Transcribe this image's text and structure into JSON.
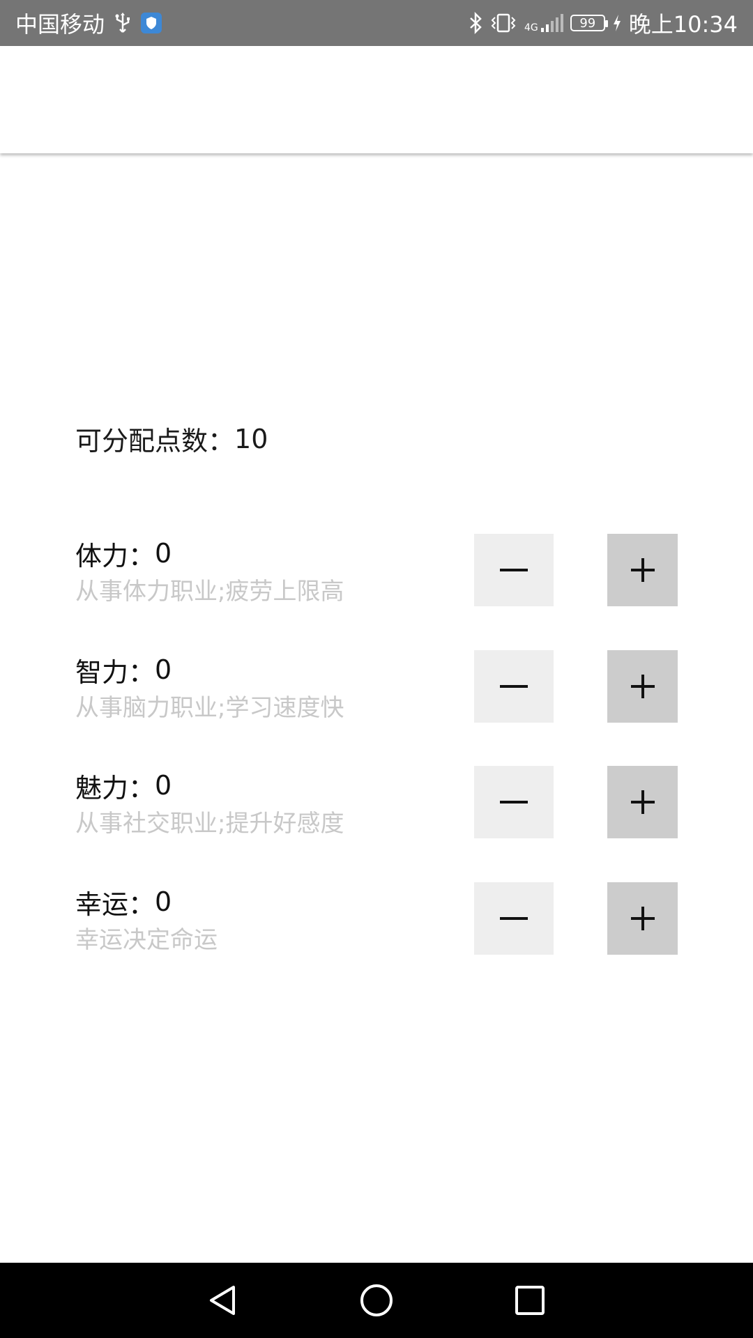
{
  "status_bar": {
    "carrier": "中国移动",
    "network": "4G",
    "battery": "99",
    "time": "晚上10:34"
  },
  "points": {
    "label": "可分配点数：",
    "value": "10"
  },
  "attributes": [
    {
      "name": "体力：",
      "value": "0",
      "desc": "从事体力职业;疲劳上限高"
    },
    {
      "name": "智力：",
      "value": "0",
      "desc": "从事脑力职业;学习速度快"
    },
    {
      "name": "魅力：",
      "value": "0",
      "desc": "从事社交职业;提升好感度"
    },
    {
      "name": "幸运：",
      "value": "0",
      "desc": "幸运决定命运"
    }
  ],
  "colors": {
    "status_bar_bg": "#757575",
    "minus_button_bg": "#eeeeee",
    "plus_button_bg": "#cccccc",
    "description_text": "#c8c8c8",
    "nav_bar_bg": "#000000"
  },
  "icons": {
    "minus": "minus-icon",
    "plus": "plus-icon",
    "nav_back": "back-triangle-icon",
    "nav_home": "home-circle-icon",
    "nav_recents": "recents-square-icon"
  }
}
